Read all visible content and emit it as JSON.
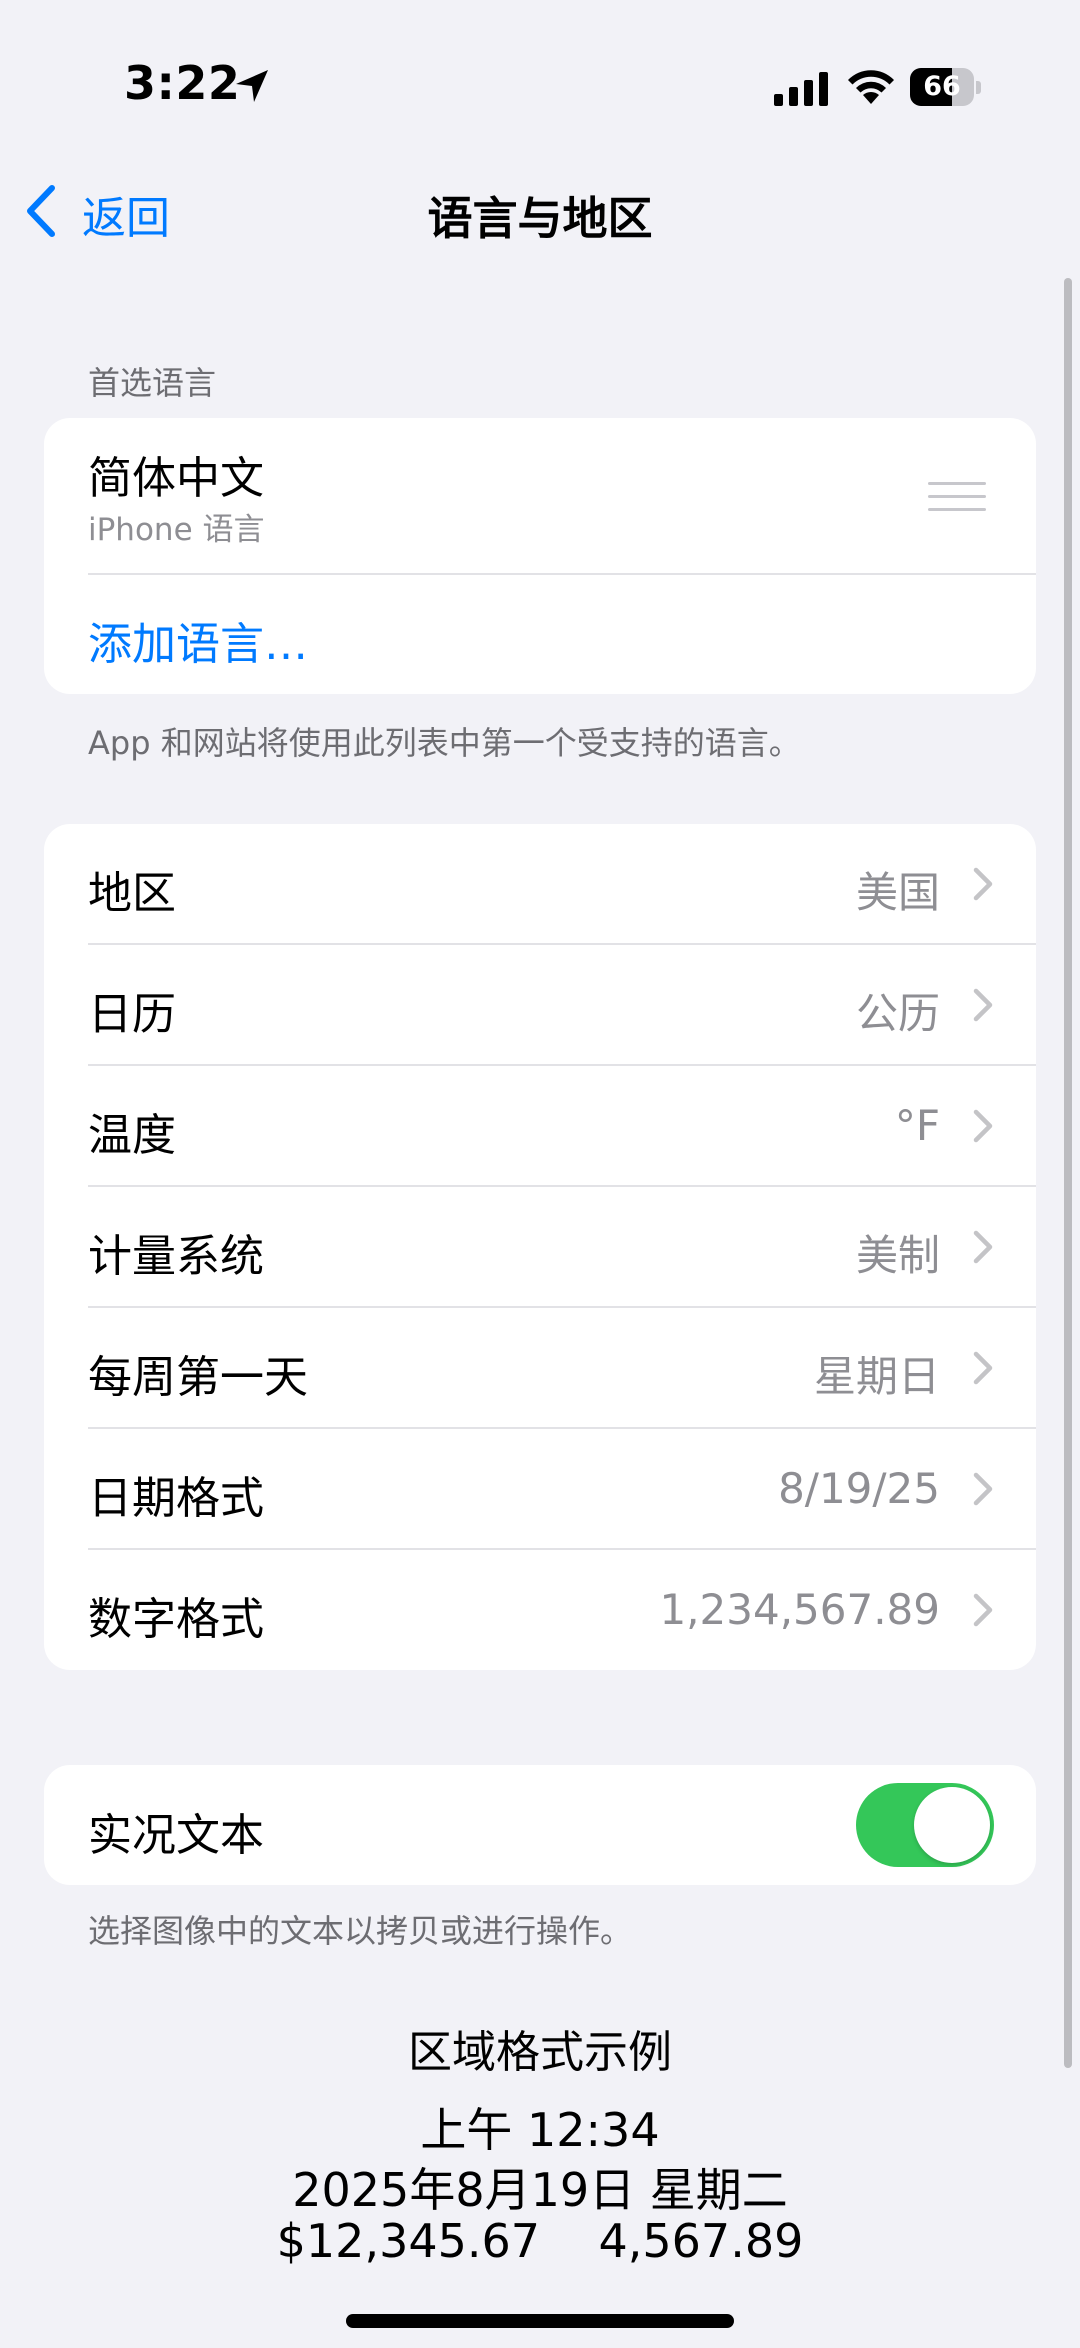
{
  "status_bar": {
    "time": "3:22",
    "location_icon": "location-arrow-icon",
    "signal_icon": "cellular-signal-icon",
    "wifi_icon": "wifi-icon",
    "battery_level": "66",
    "battery_fraction": 0.66
  },
  "nav": {
    "back_label": "返回",
    "title": "语言与地区"
  },
  "preferred_languages": {
    "header": "首选语言",
    "languages": [
      {
        "name": "简体中文",
        "subtitle": "iPhone 语言"
      }
    ],
    "add_language": "添加语言…",
    "footer": "App 和网站将使用此列表中第一个受支持的语言。"
  },
  "settings": [
    {
      "label": "地区",
      "value": "美国"
    },
    {
      "label": "日历",
      "value": "公历"
    },
    {
      "label": "温度",
      "value": "°F"
    },
    {
      "label": "计量系统",
      "value": "美制"
    },
    {
      "label": "每周第一天",
      "value": "星期日"
    },
    {
      "label": "日期格式",
      "value": "8/19/25"
    },
    {
      "label": "数字格式",
      "value": "1,234,567.89"
    }
  ],
  "live_text": {
    "label": "实况文本",
    "enabled": true,
    "footer": "选择图像中的文本以拷贝或进行操作。"
  },
  "region_example": {
    "title": "区域格式示例",
    "time": "上午 12:34",
    "date": "2025年8月19日 星期二",
    "numbers": "$12,345.67    4,567.89"
  },
  "colors": {
    "accent": "#007aff",
    "toggle_on": "#34c759",
    "background": "#f2f2f7",
    "secondary_text": "#8e8e93"
  }
}
